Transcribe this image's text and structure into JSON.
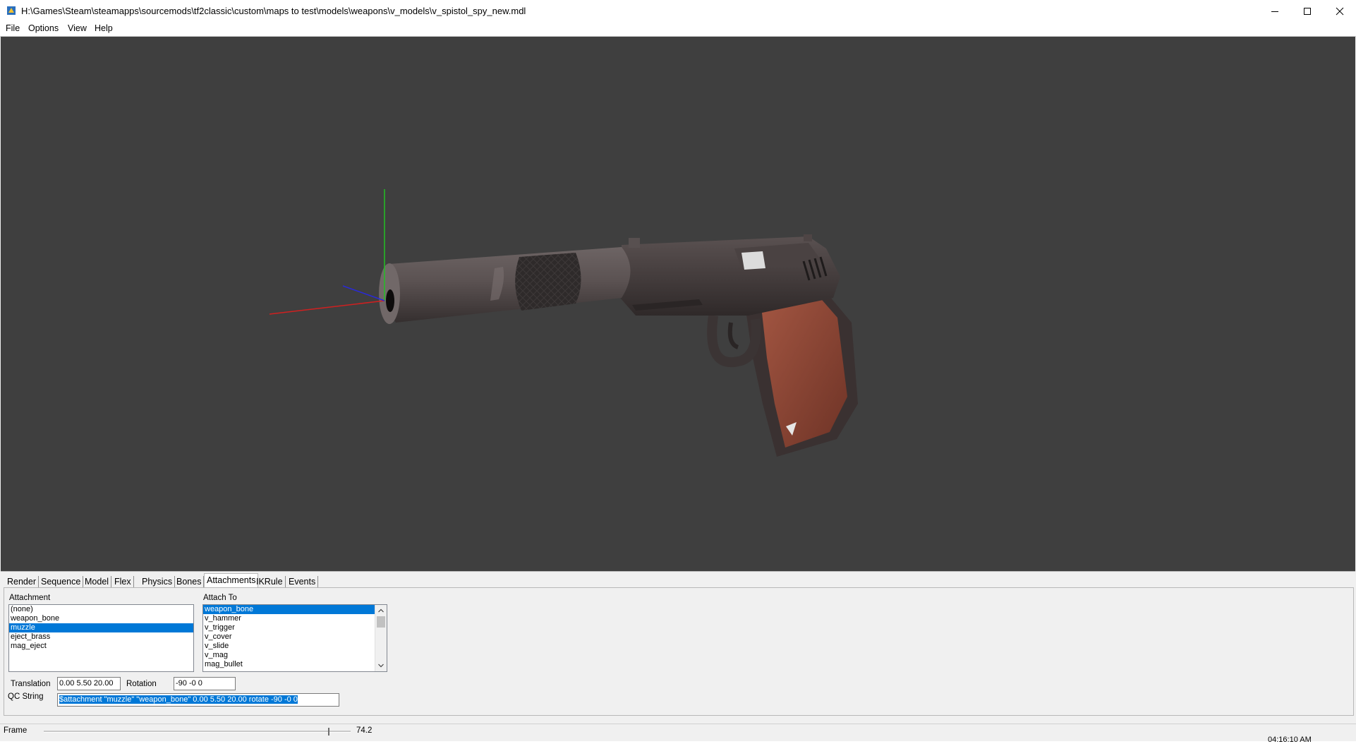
{
  "window": {
    "title": "H:\\Games\\Steam\\steamapps\\sourcemods\\tf2classic\\custom\\maps to test\\models\\weapons\\v_models\\v_spistol_spy_new.mdl"
  },
  "menu": {
    "items": [
      "File",
      "Options",
      "View",
      "Help"
    ]
  },
  "tabs": [
    "Render",
    "Sequence",
    "Model",
    "Flex",
    "Physics",
    "Bones",
    "Attachments",
    "IKRule",
    "Events"
  ],
  "active_tab": "Attachments",
  "attachments": {
    "attachment_label": "Attachment",
    "attachment_list": [
      "(none)",
      "weapon_bone",
      "muzzle",
      "eject_brass",
      "mag_eject"
    ],
    "selected_attachment": "muzzle",
    "attach_to_label": "Attach To",
    "attach_to_list": [
      "weapon_bone",
      "v_hammer",
      "v_trigger",
      "v_cover",
      "v_slide",
      "v_mag",
      "mag_bullet"
    ],
    "selected_attach_to": "weapon_bone",
    "translation_label": "Translation",
    "translation_value": "0.00 5.50 20.00",
    "rotation_label": "Rotation",
    "rotation_value": "-90 -0 0",
    "qc_label": "QC String",
    "qc_value": "$attachment \"muzzle\" \"weapon_bone\" 0.00 5.50 20.00 rotate -90 -0 0"
  },
  "frame": {
    "label": "Frame",
    "value": "74.2"
  },
  "clock": "04:16:10 AM",
  "colors": {
    "viewport_bg": "#3f3f3f",
    "selection": "#0078d7",
    "axis_x": "#d02020",
    "axis_y": "#20c020",
    "axis_z": "#2020d0",
    "grip": "#8a4433",
    "gun_body": "#4a4242"
  },
  "icons": {
    "app": "hlmv-app-icon",
    "minimize": "minimize-icon",
    "maximize": "maximize-icon",
    "close": "close-icon"
  }
}
